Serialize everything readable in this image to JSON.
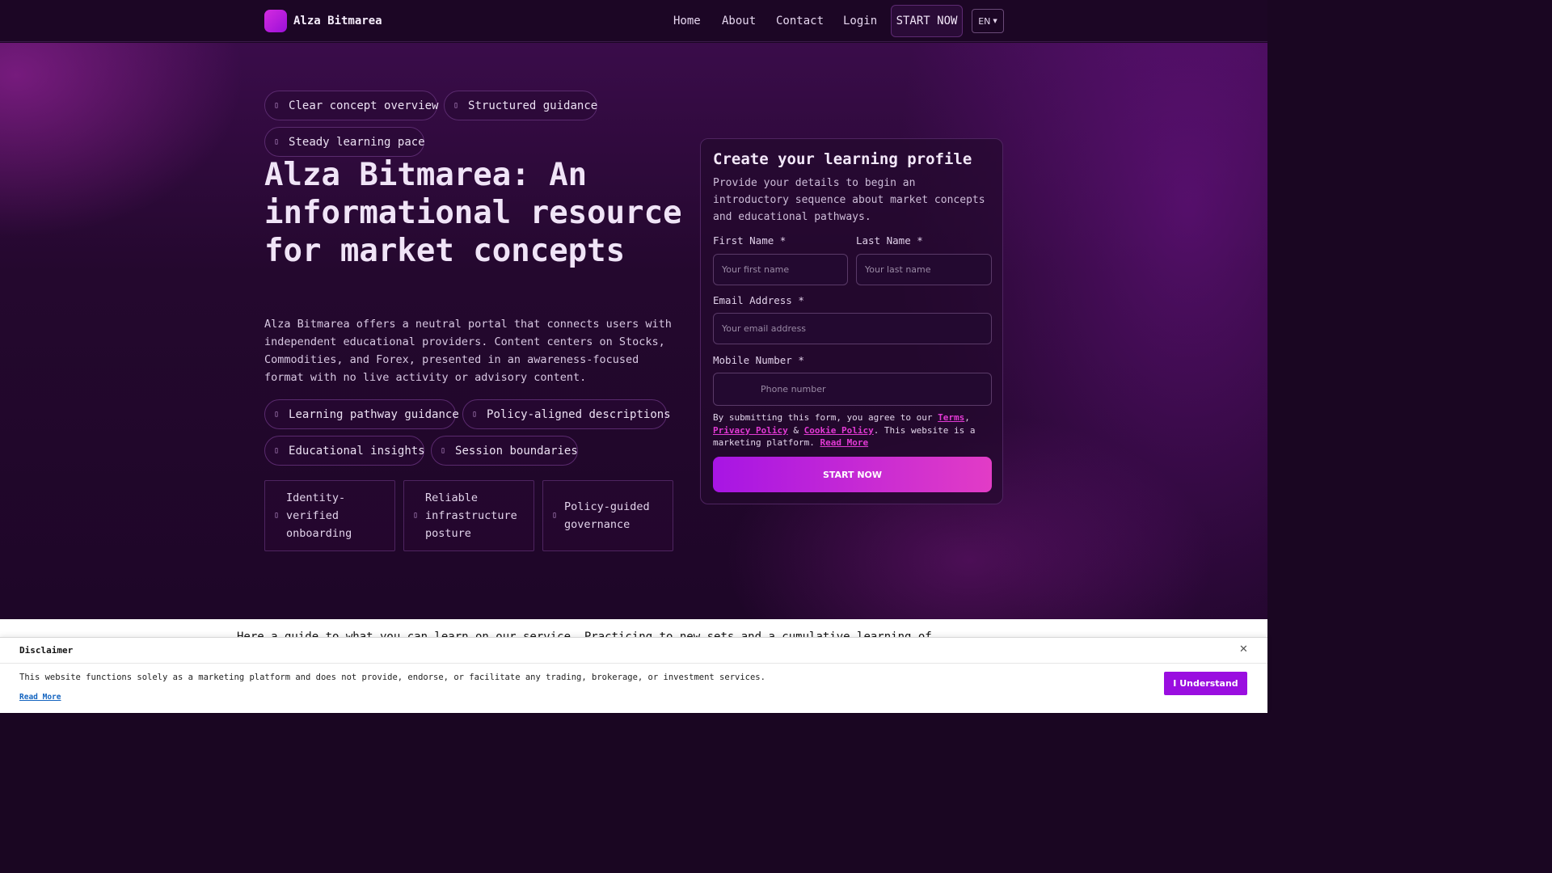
{
  "header": {
    "brand": "Alza Bitmarea",
    "nav": {
      "home": "Home",
      "about": "About",
      "contact": "Contact",
      "login": "Login"
    },
    "cta": "START NOW",
    "language": "EN"
  },
  "hero": {
    "top_chips": [
      "Clear concept overview",
      "Structured guidance",
      "Steady learning pace"
    ],
    "title": "Alza Bitmarea: An informational resource for market concepts",
    "description": "Alza Bitmarea offers a neutral portal that connects users with independent educational providers. Content centers on Stocks, Commodities, and Forex, presented in an awareness-focused format with no live activity or advisory content.",
    "bottom_chips": [
      "Learning pathway guidance",
      "Policy-aligned descriptions",
      "Educational insights",
      "Session boundaries"
    ],
    "features": [
      "Identity-verified onboarding",
      "Reliable infrastructure posture",
      "Policy-guided governance"
    ]
  },
  "form": {
    "title": "Create your learning profile",
    "description": "Provide your details to begin an introductory sequence about market concepts and educational pathways.",
    "first_name_label": "First Name *",
    "first_name_placeholder": "Your first name",
    "last_name_label": "Last Name *",
    "last_name_placeholder": "Your last name",
    "email_label": "Email Address *",
    "email_placeholder": "Your email address",
    "phone_label": "Mobile Number *",
    "phone_placeholder": "Phone number",
    "terms_prefix": "By submitting this form, you agree to our",
    "terms_link": "Terms",
    "privacy_link": "Privacy Policy",
    "cookie_link": "Cookie Policy",
    "terms_suffix": ". This website is a marketing platform.",
    "read_more": "Read More",
    "submit": "START NOW"
  },
  "below": {
    "peek_text": "Here a guide to what you can learn on our service. Practicing to new sets and a cumulative learning of..."
  },
  "disclaimer": {
    "title": "Disclaimer",
    "text": "This website functions solely as a marketing platform and does not provide, endorse, or facilitate any trading, brokerage, or investment services.",
    "read_more": "Read More",
    "button": "I Understand"
  }
}
